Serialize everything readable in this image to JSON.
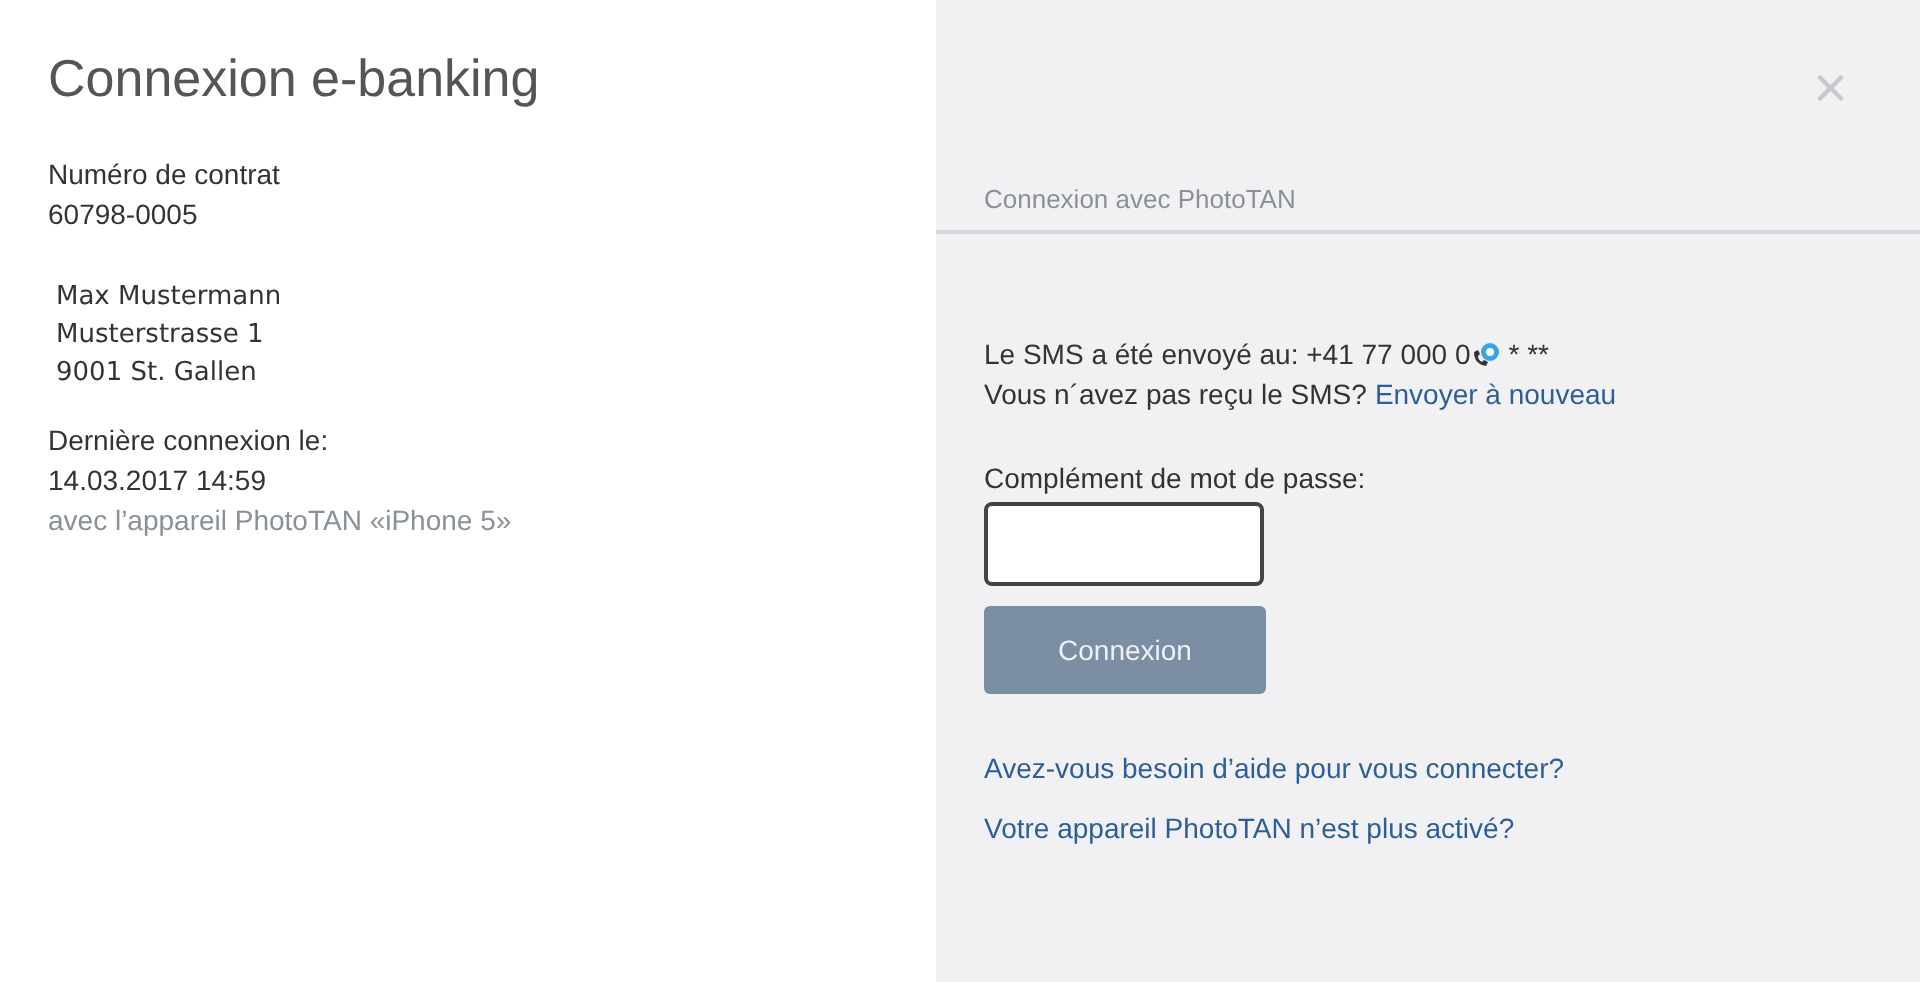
{
  "title": "Connexion e-banking",
  "contract": {
    "label": "Numéro de contrat",
    "value": "60798-0005"
  },
  "address": {
    "name": "Max Mustermann",
    "lines": [
      "Musterstrasse 1",
      "9001 St. Gallen"
    ]
  },
  "last_login": {
    "label": "Dernière connexion le:",
    "datetime": "14.03.2017 14:59",
    "device": "avec l’appareil PhotoTAN «iPhone 5»"
  },
  "close": "×",
  "panel": {
    "heading": "Connexion avec PhotoTAN",
    "sms_text": "Le SMS a été envoyé au: +41 77 000 0",
    "sms_masked": "* **",
    "not_received": "Vous n´avez pas reçu le SMS?",
    "resend_link": "Envoyer à nouveau",
    "field_label": "Complément de mot de passe:",
    "button": {
      "label": "Connexion",
      "disabled": true
    },
    "links": [
      "Avez-vous besoin d’aide pour vous connecter?",
      "Votre appareil PhotoTAN n’est plus activé?"
    ]
  }
}
